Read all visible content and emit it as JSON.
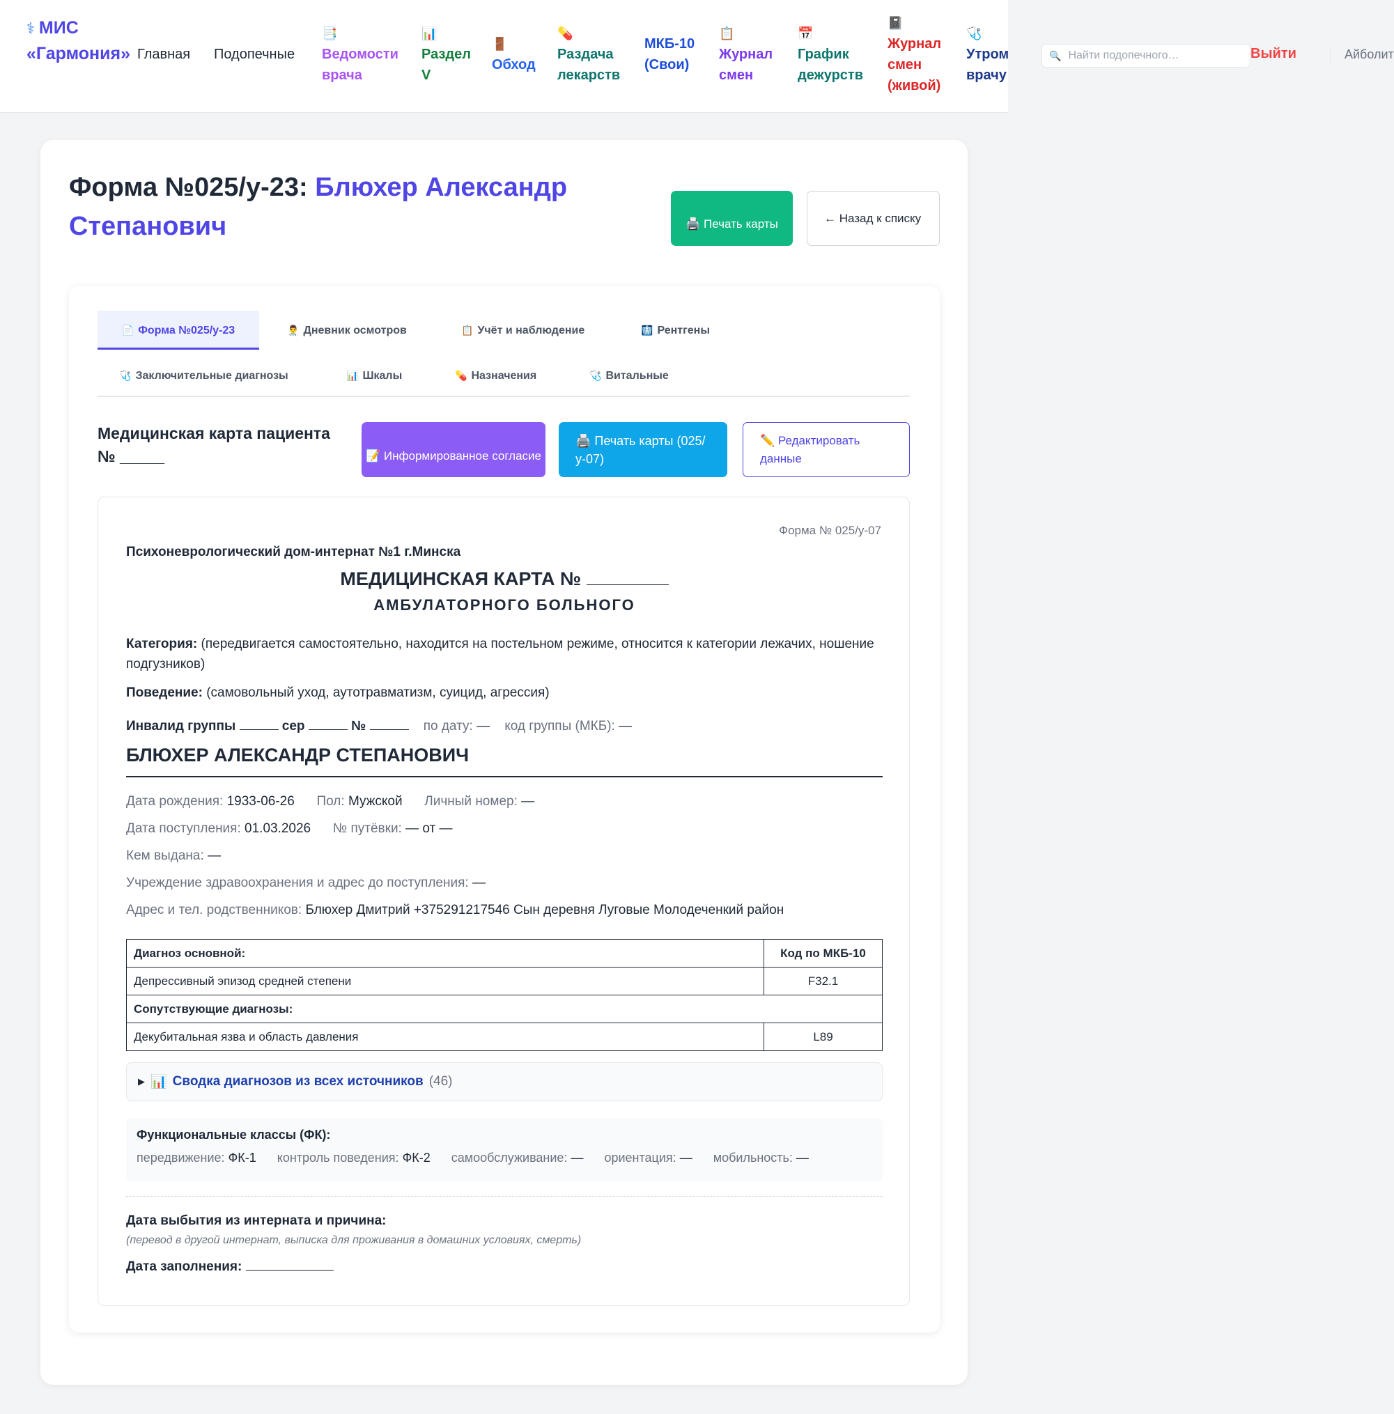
{
  "nav": {
    "brand_icon": "⚕",
    "brand": "МИС «Гармония»",
    "items": [
      {
        "label": "Главная",
        "icon": ""
      },
      {
        "label": "Подопечные",
        "icon": ""
      },
      {
        "label": "Ведомости врача",
        "icon": "📑"
      },
      {
        "label": "Раздел V",
        "icon": "📊"
      },
      {
        "label": "Обход",
        "icon": "🚪"
      },
      {
        "label": "Раздача лекарств",
        "icon": "💊"
      },
      {
        "label": "МКБ-10 (Свои)",
        "icon": ""
      },
      {
        "label": "Журнал смен",
        "icon": "📋"
      },
      {
        "label": "График дежурств",
        "icon": "📅"
      },
      {
        "label": "Журнал смен (живой)",
        "icon": "📓"
      },
      {
        "label": "Утром врачу",
        "icon": "🩺"
      }
    ],
    "colors": [
      "#4f46e5",
      "#15803d",
      "#2563eb",
      "#0f766e",
      "#1d4ed8",
      "#7c3aed",
      "#0f766e",
      "#dc2626",
      "#1e3a8a"
    ],
    "search_placeholder": "Найти подопечного…",
    "logout": "Выйти",
    "user": "Айболит"
  },
  "page": {
    "title_prefix": "Форма №025/у-23: ",
    "patient_name": "Блюхер Александр Степанович",
    "print_card_btn": "🖨️ Печать карты",
    "back_btn": "← Назад к списку"
  },
  "tabs": [
    {
      "icon": "📄",
      "label": "Форма №025/у-23",
      "active": true
    },
    {
      "icon": "👨‍⚕️",
      "label": "Дневник осмотров",
      "active": false
    },
    {
      "icon": "📋",
      "label": "Учёт и наблюдение",
      "active": false
    },
    {
      "icon": "🩻",
      "label": "Рентгены",
      "active": false
    },
    {
      "icon": "🩺",
      "label": "Заключительные диагнозы",
      "active": false
    },
    {
      "icon": "📊",
      "label": "Шкалы",
      "active": false
    },
    {
      "icon": "💊",
      "label": "Назначения",
      "active": false
    },
    {
      "icon": "🩺",
      "label": "Витальные",
      "active": false
    }
  ],
  "section": {
    "title": "Медицинская карта пациента № _____",
    "consent_btn": "📝 Информированное согласие",
    "print025_btn": "🖨️ Печать карты (025/у-07)",
    "edit_btn": "✏️ Редактировать данные"
  },
  "doc": {
    "form_no": "Форма № 025/у-07",
    "institution": "Психоневрологический дом-интернат №1 г.Минска",
    "heading_main": "МЕДИЦИНСКАЯ КАРТА №",
    "heading_sub": "АМБУЛАТОРНОГО БОЛЬНОГО",
    "category_label": "Категория:",
    "category_text": "(передвигается самостоятельно, находится на постельном режиме, относится к категории лежачих, ношение подгузников)",
    "behavior_label": "Поведение:",
    "behavior_text": "(самовольный уход, аутотравматизм, суицид, агрессия)",
    "disability": {
      "group_label": "Инвалид группы",
      "ser_label": "сер",
      "no_label": "№",
      "by_date_label": "по дату:",
      "by_date_value": "—",
      "code_label": "код группы (МКБ):",
      "code_value": "—"
    },
    "patient_full_name": "БЛЮХЕР АЛЕКСАНДР СТЕПАНОВИЧ",
    "birth_label": "Дата рождения:",
    "birth_value": "1933-06-26",
    "sex_label": "Пол:",
    "sex_value": "Мужской",
    "personal_label": "Личный номер:",
    "personal_value": "—",
    "admission_label": "Дата поступления:",
    "admission_value": "01.03.2026",
    "voucher_label": "№ путёвки:",
    "voucher_value": "— от —",
    "issued_label": "Кем выдана:",
    "issued_value": "—",
    "prev_inst_label": "Учреждение здравоохранения и адрес до поступления:",
    "prev_inst_value": "—",
    "relatives_label": "Адрес и тел. родственников:",
    "relatives_value": "Блюхер Дмитрий +375291217546 Сын деревня Луговые Молодеченкий район",
    "diag_main_header": "Диагноз основной:",
    "diag_code_header": "Код по МКБ-10",
    "diag_main": "Депрессивный эпизод средней степени",
    "diag_main_code": "F32.1",
    "diag_comorb_header": "Сопутствующие диагнозы:",
    "diag_comorb": "Декубитальная язва и область давления",
    "diag_comorb_code": "L89",
    "summary_icon": "📊",
    "summary_label": "Сводка диагнозов из всех источников",
    "summary_count": "(46)",
    "fk_title": "Функциональные классы (ФК):",
    "fk": [
      {
        "label": "передвижение:",
        "value": "ФК-1"
      },
      {
        "label": "контроль поведения:",
        "value": "ФК-2"
      },
      {
        "label": "самообслуживание:",
        "value": "—"
      },
      {
        "label": "ориентация:",
        "value": "—"
      },
      {
        "label": "мобильность:",
        "value": "—"
      }
    ],
    "discharge_title": "Дата выбытия из интерната и причина:",
    "discharge_note": "(перевод в другой интернат, выписка для проживания в домашних условиях, смерть)",
    "fill_date_label": "Дата заполнения:"
  }
}
